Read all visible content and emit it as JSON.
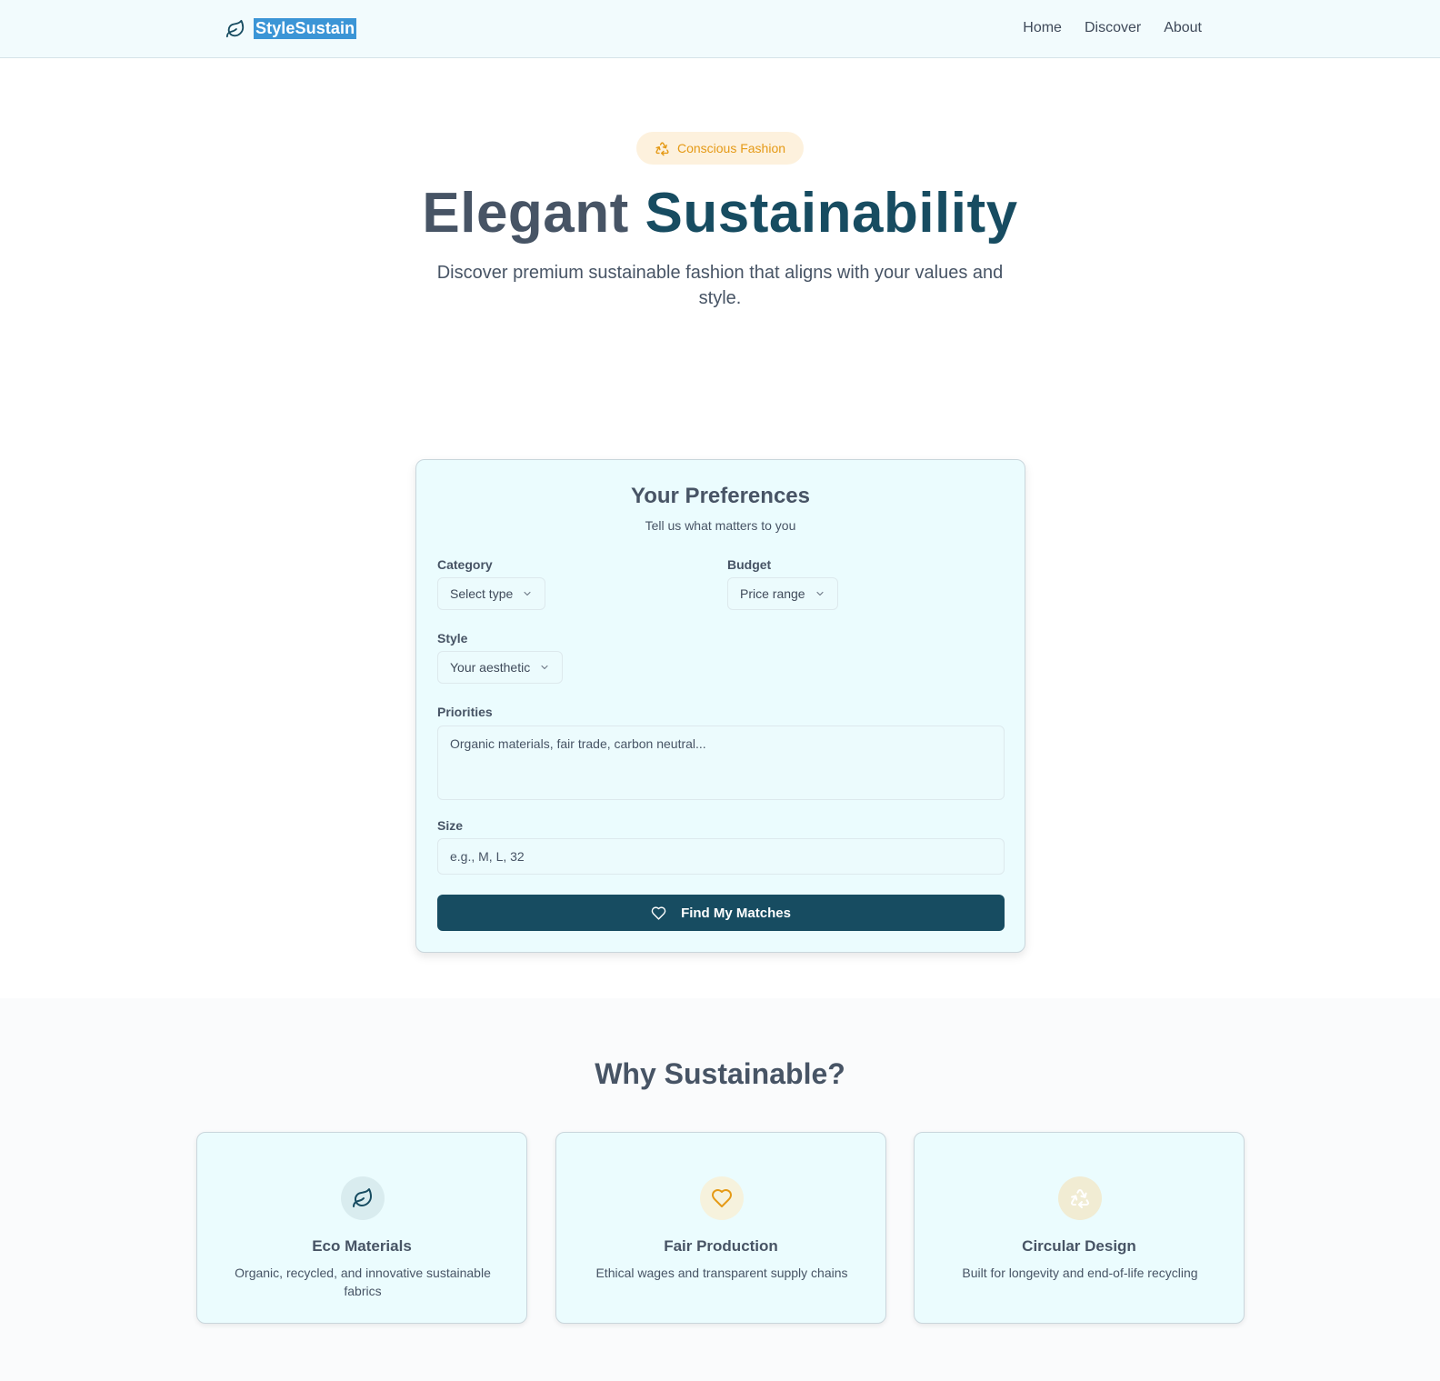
{
  "nav": {
    "brand": "StyleSustain",
    "brand_icon": "leaf-icon",
    "links": [
      {
        "label": "Home"
      },
      {
        "label": "Discover"
      },
      {
        "label": "About"
      }
    ]
  },
  "hero": {
    "badge": "Conscious Fashion",
    "badge_icon": "recycle-icon",
    "title_part1": "Elegant",
    "title_part2": "Sustainability",
    "subtitle": "Discover premium sustainable fashion that aligns with your values and style."
  },
  "preferences": {
    "title": "Your Preferences",
    "subtitle": "Tell us what matters to you",
    "category": {
      "label": "Category",
      "value": "Select type"
    },
    "budget": {
      "label": "Budget",
      "value": "Price range"
    },
    "style": {
      "label": "Style",
      "value": "Your aesthetic"
    },
    "priorities": {
      "label": "Priorities",
      "placeholder": "Organic materials, fair trade, carbon neutral..."
    },
    "size": {
      "label": "Size",
      "placeholder": "e.g., M, L, 32"
    },
    "submit": {
      "label": "Find My Matches",
      "icon": "heart-icon"
    }
  },
  "why": {
    "title": "Why Sustainable?",
    "features": [
      {
        "title": "Eco Materials",
        "desc": "Organic, recycled, and innovative sustainable fabrics",
        "icon": "leaf-icon"
      },
      {
        "title": "Fair Production",
        "desc": "Ethical wages and transparent supply chains",
        "icon": "heart-icon"
      },
      {
        "title": "Circular Design",
        "desc": "Built for longevity and end-of-life recycling",
        "icon": "recycle-icon"
      }
    ]
  },
  "colors": {
    "primary": "#174c61",
    "accent": "#e59a16",
    "nav_bg": "#f2fbfd",
    "card_bg": "#ebfcfe",
    "text": "#475465"
  }
}
